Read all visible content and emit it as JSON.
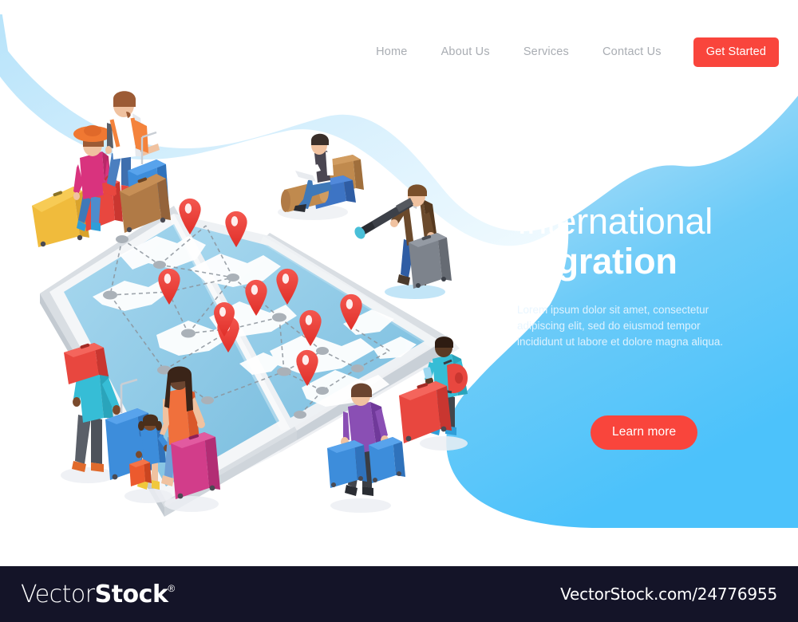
{
  "nav": {
    "links": [
      {
        "label": "Home",
        "name": "nav-link-home"
      },
      {
        "label": "About Us",
        "name": "nav-link-about-us"
      },
      {
        "label": "Services",
        "name": "nav-link-services"
      },
      {
        "label": "Contact Us",
        "name": "nav-link-contact-us"
      }
    ],
    "cta_label": "Get Started"
  },
  "hero": {
    "title_line1": "International",
    "title_line2": "Migration",
    "subtitle": "Lorem ipsum dolor sit amet, consectetur adipiscing elit, sed do eiusmod tempor incididunt ut labore et dolore magna aliqua.",
    "button_label": "Learn more"
  },
  "footer": {
    "logo_part1": "Vector",
    "logo_part2": "Stock",
    "logo_registered": "®",
    "url": "VectorStock.com/24776955"
  },
  "colors": {
    "accent_red": "#f9453c",
    "sky_blue": "#5cc8f8",
    "pale_blue": "#bfe7fb",
    "nav_text": "#a9adb3",
    "hero_text": "#ffffff",
    "footer_bg": "#141428",
    "map_water": "#8ec6e6",
    "map_land": "#ffffff",
    "pin_red": "#ef3b35"
  },
  "illustration": {
    "title": "isometric world map with location pins and travellers",
    "map_pins_count": 10,
    "figures": [
      {
        "name": "figure-couple-travellers",
        "desc": "woman in orange hat with pink top and man with backpack, top left"
      },
      {
        "name": "figure-man-reading-book",
        "desc": "man sitting on luggage reading a book"
      },
      {
        "name": "figure-man-with-telescope",
        "desc": "man with spyglass and grey suitcase"
      },
      {
        "name": "figure-family-of-three",
        "desc": "man with cap, woman and girl with suitcases, bottom left"
      },
      {
        "name": "figure-man-two-blue-bags",
        "desc": "man in purple jacket carrying two blue bags"
      },
      {
        "name": "figure-man-with-phone",
        "desc": "man in teal shirt with phone, backpack and red suitcase"
      }
    ]
  }
}
